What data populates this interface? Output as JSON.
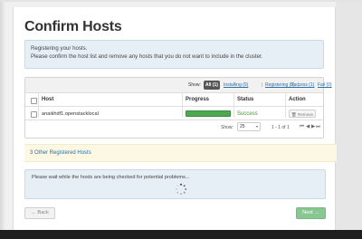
{
  "page": {
    "title": "Confirm Hosts"
  },
  "info": {
    "line1": "Registering your hosts.",
    "line2": "Please confirm the host list and remove any hosts that you do not want to include in the cluster."
  },
  "filters": {
    "show_label": "Show:",
    "all": "All (1)",
    "installing": "Installing (0)",
    "registering": "Registering (0)",
    "success": "Success (1)",
    "fail": "Fail (0)",
    "separator": "|"
  },
  "table": {
    "columns": [
      "Host",
      "Progress",
      "Status",
      "Action"
    ],
    "rows": [
      {
        "host": "anaikhdf1.openstacklocal",
        "progress": 1.0,
        "status": "Success",
        "action": "Remove",
        "action_icon": "trash-icon"
      }
    ],
    "pager": {
      "show_label": "Show:",
      "page_size": "25",
      "range": "1 - 1 of 1",
      "nav_first": "⏮",
      "nav_prev": "◀",
      "nav_next": "▶",
      "nav_last": "⏭"
    }
  },
  "other_hosts": {
    "label": "3 Other Registered Hosts"
  },
  "wait": {
    "message": "Please wait while the hosts are being checked for potential problems..."
  },
  "buttons": {
    "back": "← Back",
    "next": "Next →"
  },
  "colors": {
    "success": "#4a8f3c",
    "progress_fill": "#4ea84e",
    "link": "#2b6fa5",
    "info_bg": "#e6eff5",
    "warning_bg": "#fcf8e3",
    "next_button": "#88c792"
  }
}
